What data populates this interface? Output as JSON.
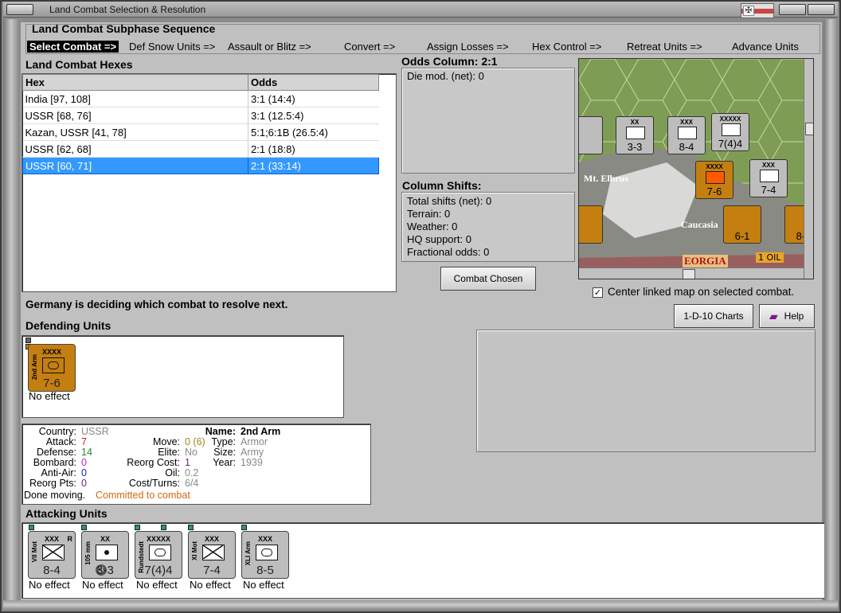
{
  "window": {
    "title": "Land Combat Selection & Resolution"
  },
  "subphase": {
    "heading": "Land Combat Subphase Sequence",
    "steps": [
      "Select Combat =>",
      "Def Snow Units =>",
      "Assault or Blitz =>",
      "Convert =>",
      "Assign Losses =>",
      "Hex Control =>",
      "Retreat Units =>",
      "Advance Units"
    ]
  },
  "hexes": {
    "heading": "Land Combat Hexes",
    "columns": [
      "Hex",
      "Odds"
    ],
    "rows": [
      {
        "hex": "India [97, 108]",
        "odds": "3:1 (14:4)"
      },
      {
        "hex": "USSR [68, 76]",
        "odds": "3:1 (12.5:4)"
      },
      {
        "hex": "Kazan, USSR [41, 78]",
        "odds": "5:1;6:1B (26.5:4)"
      },
      {
        "hex": "USSR [62, 68]",
        "odds": "2:1 (18:8)"
      },
      {
        "hex": "USSR [60, 71]",
        "odds": "2:1 (33:14)"
      }
    ]
  },
  "odds": {
    "heading": "Odds Column: 2:1",
    "die_mod": "Die mod. (net): 0"
  },
  "shifts": {
    "heading": "Column Shifts:",
    "lines": [
      "Total shifts (net): 0",
      "Terrain: 0",
      "Weather: 0",
      "HQ support: 0",
      "Fractional odds: 0"
    ]
  },
  "buttons": {
    "combat_chosen": "Combat Chosen",
    "charts": "1-D-10 Charts",
    "help": "Help"
  },
  "map": {
    "labels": [
      "Mt. Elbrus",
      "Caucasia",
      "EORGIA",
      "1 OIL"
    ],
    "center_linked_label": "Center linked map on selected combat.",
    "center_linked_checked": true
  },
  "status": "Germany is deciding which combat to resolve next.",
  "defending": {
    "heading": "Defending Units",
    "units": [
      {
        "name": "2nd Arm",
        "size": "XXXX",
        "vals": "7-6",
        "effect": "No effect"
      }
    ]
  },
  "detail": {
    "country_label": "Country:",
    "country": "USSR",
    "attack_label": "Attack:",
    "attack": "7",
    "defense_label": "Defense:",
    "defense": "14",
    "bombard_label": "Bombard:",
    "bombard": "0",
    "antiair_label": "Anti-Air:",
    "antiair": "0",
    "reorgpts_label": "Reorg Pts:",
    "reorgpts": "0",
    "move_label": "Move:",
    "move": "0 (6)",
    "elite_label": "Elite:",
    "elite": "No",
    "reorgcost_label": "Reorg Cost:",
    "reorgcost": "1",
    "oil_label": "Oil:",
    "oil": "0.2",
    "costturns_label": "Cost/Turns:",
    "costturns": "6/4",
    "name_label": "Name:",
    "name": "2nd Arm",
    "type_label": "Type:",
    "type": "Armor",
    "size_label": "Size:",
    "size": "Army",
    "year_label": "Year:",
    "year": "1939",
    "done": "Done moving.",
    "committed": "Committed to combat"
  },
  "attacking": {
    "heading": "Attacking Units",
    "units": [
      {
        "name": "VII Mot",
        "size": "XXX",
        "vals": "8-4",
        "effect": "No effect",
        "r": "R"
      },
      {
        "name": "105 mm",
        "size": "XX",
        "vals": "3-3",
        "effect": "No effect",
        "badge": "3"
      },
      {
        "name": "Rundstedt",
        "size": "XXXXX",
        "vals": "7(4)4",
        "effect": "No effect"
      },
      {
        "name": "XI Mot",
        "size": "XXX",
        "vals": "7-4",
        "effect": "No effect"
      },
      {
        "name": "XLI Arm",
        "size": "XXX",
        "vals": "8-5",
        "effect": "No effect"
      }
    ]
  },
  "colors": {
    "selection": "#3399ff",
    "ussr_counter": "#c47f10",
    "german_counter": "#bdbdbd",
    "attack": "#cc2222",
    "defense": "#228822"
  }
}
